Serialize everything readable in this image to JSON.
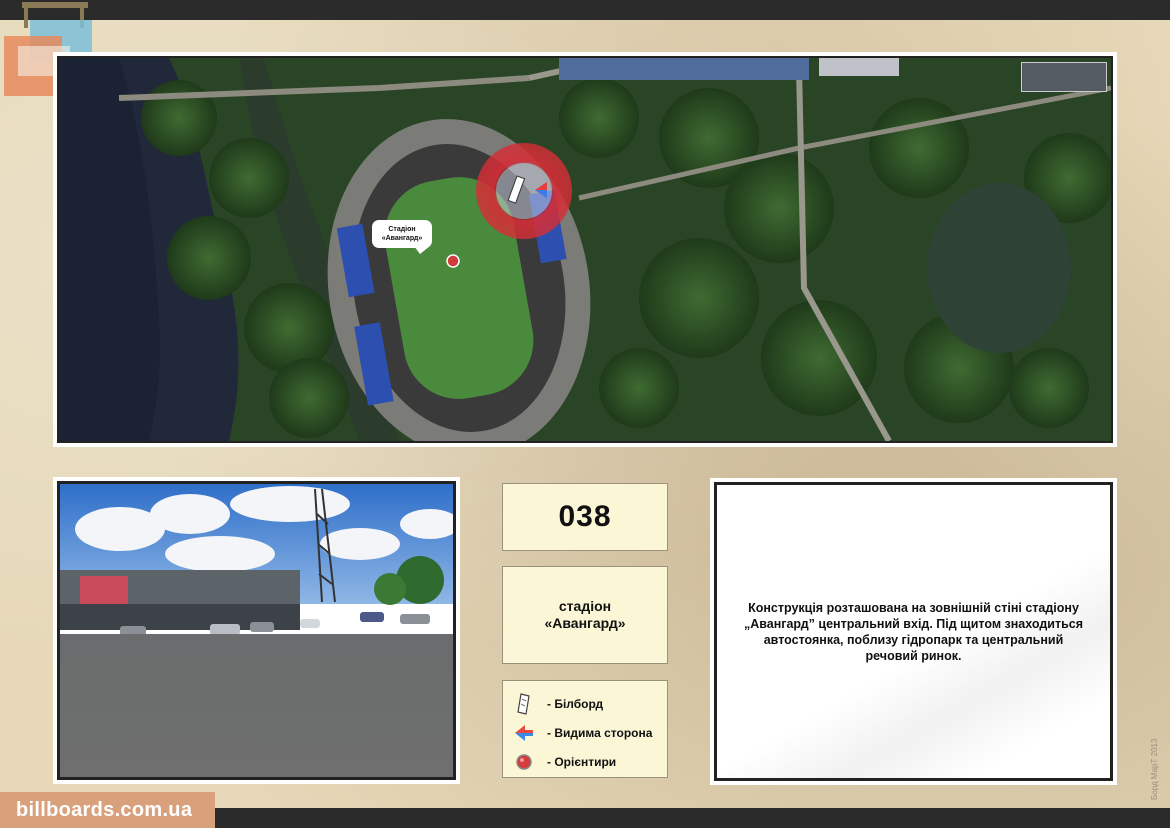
{
  "map": {
    "landmark_label_line1": "Стадіон",
    "landmark_label_line2": "«Авангард»"
  },
  "board": {
    "id": "038",
    "name_line1": "стадіон",
    "name_line2": "«Авангард»"
  },
  "legend": [
    {
      "icon": "billboard-icon",
      "label": "- Білборд"
    },
    {
      "icon": "visible-side-arrow-icon",
      "label": "- Видима сторона"
    },
    {
      "icon": "landmark-dot-icon",
      "label": "- Орієнтири"
    }
  ],
  "description": "Конструкція розташована на зовнішній стіні стадіону „Авангард” центральний вхід. Під щитом знаходиться  автостоянка, поблизу гідропарк та центральний речовий ринок.",
  "footer": {
    "site": "billboards.com.ua",
    "copyright": "Борд МарТ 2013"
  },
  "colors": {
    "marker_ring": "#d62d36",
    "brand_bar": "#d9a07c",
    "panel": "#fbf6d6"
  }
}
